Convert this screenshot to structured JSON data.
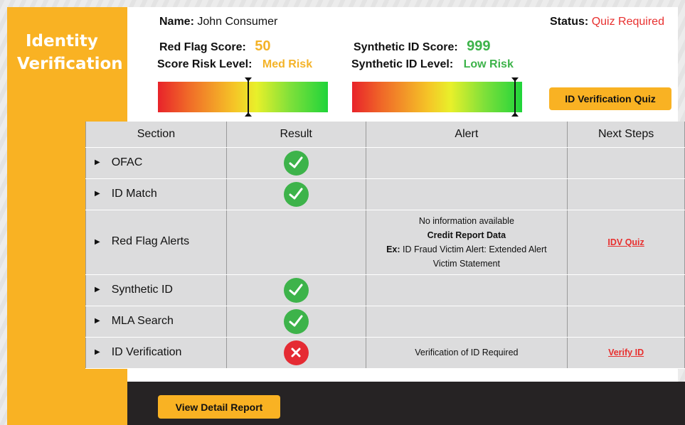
{
  "sidebar": {
    "title_line1": "Identity",
    "title_line2": "Verification"
  },
  "header": {
    "name_label": "Name:",
    "name_value": "John Consumer",
    "status_label": "Status:",
    "status_value": "Quiz Required",
    "red_flag_label": "Red Flag Score:",
    "red_flag_value": "50",
    "score_risk_label": "Score Risk Level:",
    "score_risk_value": "Med Risk",
    "synthetic_label": "Synthetic ID Score:",
    "synthetic_value": "999",
    "synthetic_level_label": "Synthetic ID Level:",
    "synthetic_level_value": "Low Risk"
  },
  "gauges": {
    "red_flag_position": 0.53,
    "synthetic_position": 0.96
  },
  "buttons": {
    "quiz": "ID Verification Quiz",
    "detail": "View Detail Report"
  },
  "table": {
    "headers": [
      "Section",
      "Result",
      "Alert",
      "Next Steps"
    ],
    "rows": [
      {
        "section": "OFAC",
        "result": "pass",
        "alert_lines": [],
        "next": ""
      },
      {
        "section": "ID Match",
        "result": "pass",
        "alert_lines": [],
        "next": ""
      },
      {
        "section": "Red Flag Alerts",
        "result": "",
        "alert_line1": "No information available",
        "alert_line2": "Credit Report Data",
        "alert_line3_bold": "Ex:",
        "alert_line3": " ID Fraud Victim Alert: Extended Alert",
        "alert_line4": "Victim Statement",
        "next": "IDV Quiz"
      },
      {
        "section": "Synthetic ID",
        "result": "pass",
        "alert_lines": [],
        "next": ""
      },
      {
        "section": "MLA Search",
        "result": "pass",
        "alert_lines": [],
        "next": ""
      },
      {
        "section": "ID Verification",
        "result": "fail",
        "alert": "Verification of ID Required",
        "next": "Verify ID"
      }
    ]
  },
  "colors": {
    "accent": "#f9b223",
    "pass": "#3db34a",
    "fail": "#e52b33",
    "warning_text": "#e8302f"
  },
  "icons": {
    "pass": "check-circle-icon",
    "fail": "x-circle-icon",
    "expand": "triangle-right-icon"
  }
}
